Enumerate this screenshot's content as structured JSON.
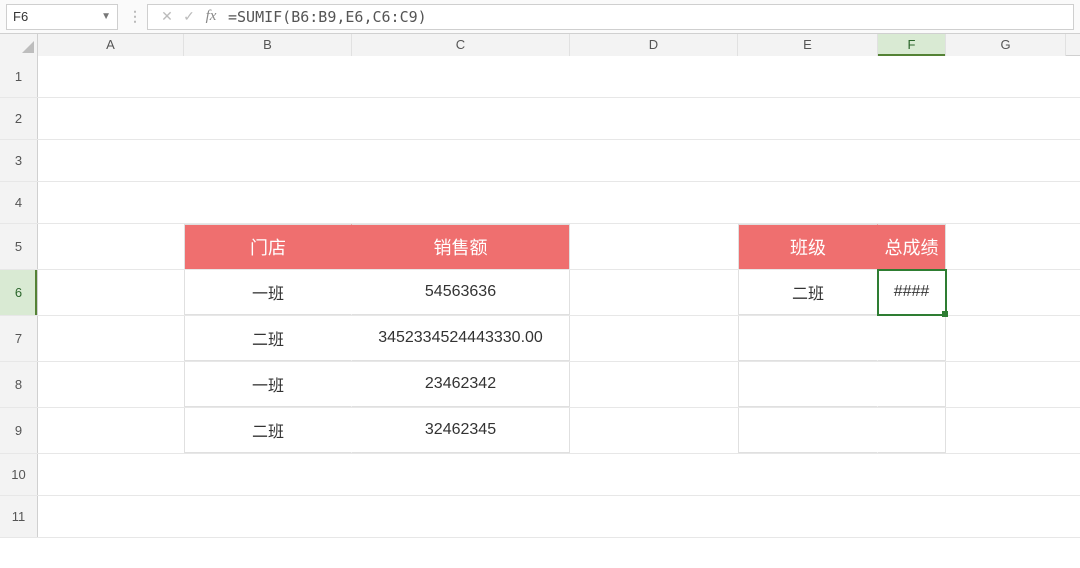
{
  "formula_bar": {
    "cell_ref": "F6",
    "fx_label": "fx",
    "formula": "=SUMIF(B6:B9,E6,C6:C9)"
  },
  "columns": [
    "A",
    "B",
    "C",
    "D",
    "E",
    "F",
    "G"
  ],
  "rows": [
    "1",
    "2",
    "3",
    "4",
    "5",
    "6",
    "7",
    "8",
    "9",
    "10",
    "11"
  ],
  "active": {
    "col": "F",
    "row": "6"
  },
  "table_left": {
    "headers": {
      "store": "门店",
      "sales": "销售额"
    },
    "rows": [
      {
        "store": "一班",
        "sales": "54563636"
      },
      {
        "store": "二班",
        "sales": "3452334524443330.00"
      },
      {
        "store": "一班",
        "sales": "23462342"
      },
      {
        "store": "二班",
        "sales": "32462345"
      }
    ]
  },
  "table_right": {
    "headers": {
      "class": "班级",
      "total": "总成绩"
    },
    "rows": [
      {
        "class": "二班",
        "total": "####"
      },
      {
        "class": "",
        "total": ""
      },
      {
        "class": "",
        "total": ""
      },
      {
        "class": "",
        "total": ""
      }
    ]
  },
  "chart_data": {
    "type": "table",
    "tables": [
      {
        "title": "left",
        "columns": [
          "门店",
          "销售额"
        ],
        "rows": [
          [
            "一班",
            54563636
          ],
          [
            "二班",
            3452334524443330.0
          ],
          [
            "一班",
            23462342
          ],
          [
            "二班",
            32462345
          ]
        ]
      },
      {
        "title": "right",
        "columns": [
          "班级",
          "总成绩"
        ],
        "rows": [
          [
            "二班",
            "####"
          ]
        ]
      }
    ]
  }
}
